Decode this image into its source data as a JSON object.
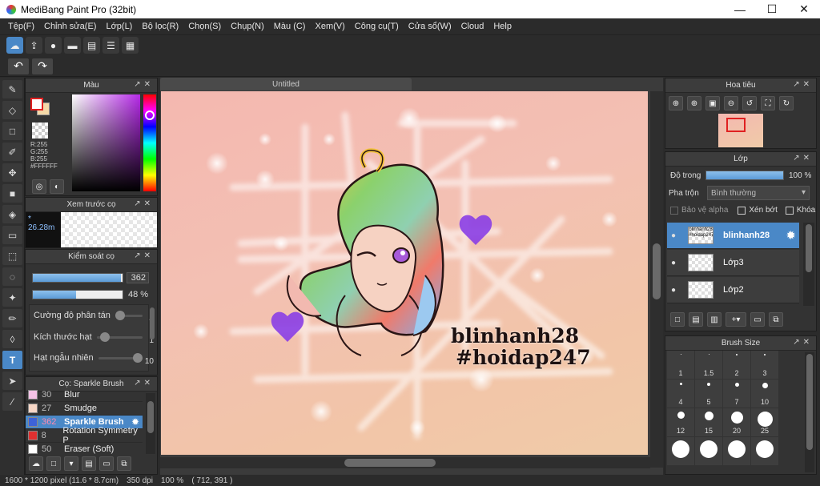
{
  "window": {
    "title": "MediBang Paint Pro (32bit)",
    "minimize": "—",
    "maximize": "☐",
    "close": "✕"
  },
  "menu": [
    "Tệp(F)",
    "Chỉnh sửa(E)",
    "Lớp(L)",
    "Bộ lọc(R)",
    "Chọn(S)",
    "Chụp(N)",
    "Màu (C)",
    "Xem(V)",
    "Công cụ(T)",
    "Cửa sổ(W)",
    "Cloud",
    "Help"
  ],
  "toolbar": {
    "icons": [
      "cloud-save-icon",
      "share-icon",
      "comment-icon",
      "message-icon",
      "page-icon",
      "page-list-icon",
      "grid-icon"
    ]
  },
  "history": {
    "undo": "↶",
    "redo": "↷"
  },
  "color_panel": {
    "title": "Màu",
    "r": "R:255",
    "g": "G:255",
    "b": "B:255",
    "hex": "#FFFFFF",
    "primary": "#ffffff",
    "secondary": "#f5d9a8"
  },
  "brush_preview": {
    "title": "Xem trước cọ",
    "size": "* 26.28m"
  },
  "brush_control": {
    "title": "Kiểm soát cọ",
    "size_value": "362",
    "size_fraction": 0.98,
    "opacity_value": "48 %",
    "opacity_fraction": 0.48,
    "scatter_label": "Cường độ phân tán",
    "scatter_value": "4",
    "particle_size_label": "Kích thước hạt",
    "particle_size_value": "1",
    "random_label": "Hạt ngẫu nhiên",
    "random_value": "10"
  },
  "brush_list": {
    "title": "Cọ: Sparkle Brush",
    "items": [
      {
        "num": "30",
        "name": "Blur",
        "color": "#f4c2e6"
      },
      {
        "num": "27",
        "name": "Smudge",
        "color": "#f6d6c6"
      },
      {
        "num": "362",
        "name": "Sparkle Brush",
        "color": "#3d62d8"
      },
      {
        "num": "8",
        "name": "Rotation Symmetry P",
        "color": "#e03030"
      },
      {
        "num": "50",
        "name": "Eraser (Soft)",
        "color": "#ffffff"
      }
    ]
  },
  "document": {
    "tab": "Untitled",
    "signature_line1": "blinhanh28",
    "signature_line2": "#hoidap247"
  },
  "navigator": {
    "title": "Hoa tiêu"
  },
  "layers": {
    "title": "Lớp",
    "opacity_label": "Độ trong",
    "opacity_value": "100 %",
    "opacity_fraction": 1.0,
    "blend_label": "Pha trộn",
    "blend_value": "Bình thường",
    "protect_alpha": "Bảo vệ alpha",
    "clipping": "Xén bớt",
    "lock": "Khóa",
    "items": [
      {
        "name": "blinhanh28",
        "thumb": "blinhanh28 #hoidap247"
      },
      {
        "name": "Lớp3",
        "thumb": ""
      },
      {
        "name": "Lớp2",
        "thumb": ""
      }
    ]
  },
  "brush_size": {
    "title": "Brush Size",
    "sizes": [
      "1",
      "1.5",
      "2",
      "3",
      "4",
      "5",
      "7",
      "10",
      "12",
      "15",
      "20",
      "25",
      "",
      "",
      "",
      ""
    ]
  },
  "status": {
    "dims": "1600 * 1200 pixel",
    "cm": "(11.6 * 8.7cm)",
    "dpi": "350 dpi",
    "zoom": "100 %",
    "coords": "( 712, 391 )"
  }
}
